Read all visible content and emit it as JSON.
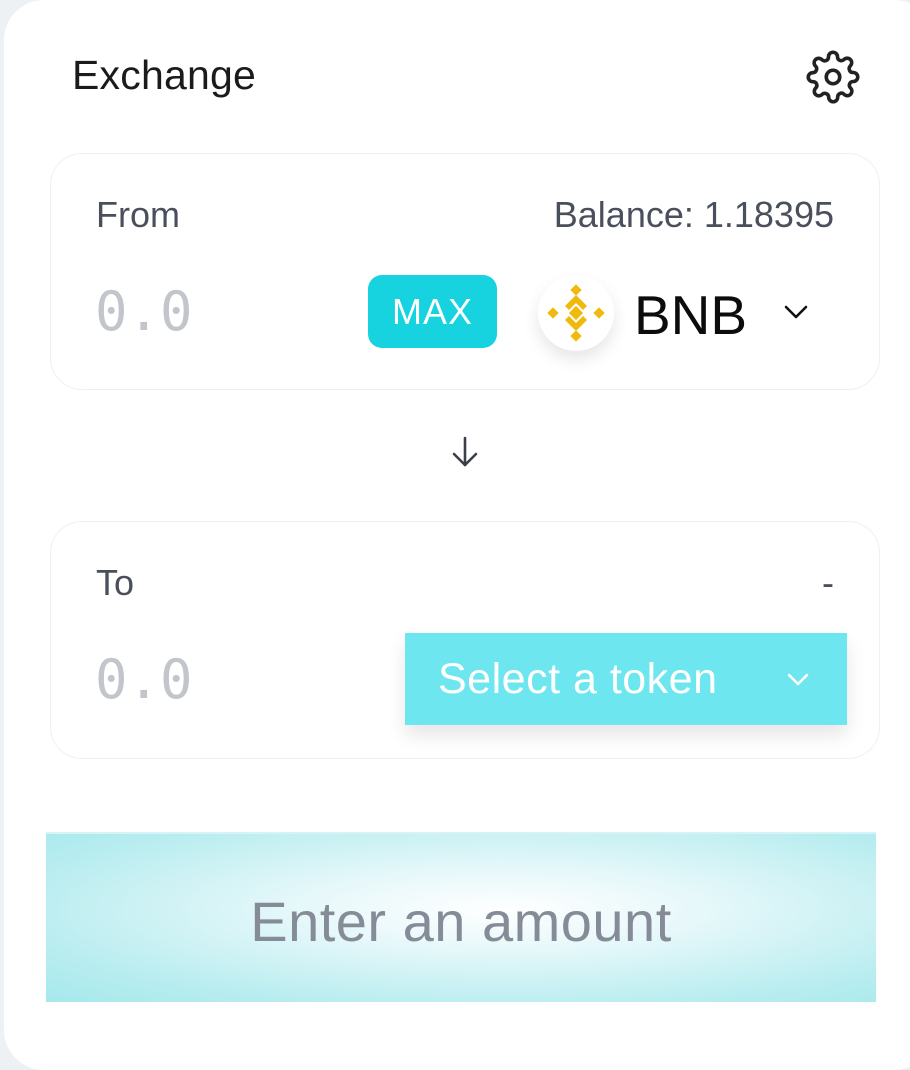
{
  "header": {
    "title": "Exchange",
    "settings_icon": "gear-icon"
  },
  "from": {
    "label": "From",
    "balance": "Balance: 1.18395",
    "amount_placeholder": "0.0",
    "max_label": "MAX",
    "token_symbol": "BNB",
    "token_icon": "bnb-logo-icon",
    "token_color": "#F0B90B"
  },
  "swap": {
    "icon": "arrow-down-icon"
  },
  "to": {
    "label": "To",
    "balance": "-",
    "amount_placeholder": "0.0",
    "select_label": "Select a token"
  },
  "action": {
    "label": "Enter an amount"
  },
  "colors": {
    "accent": "#16D3DF",
    "select_button": "#6DE6F0",
    "action_button": "#A5E8EC"
  }
}
